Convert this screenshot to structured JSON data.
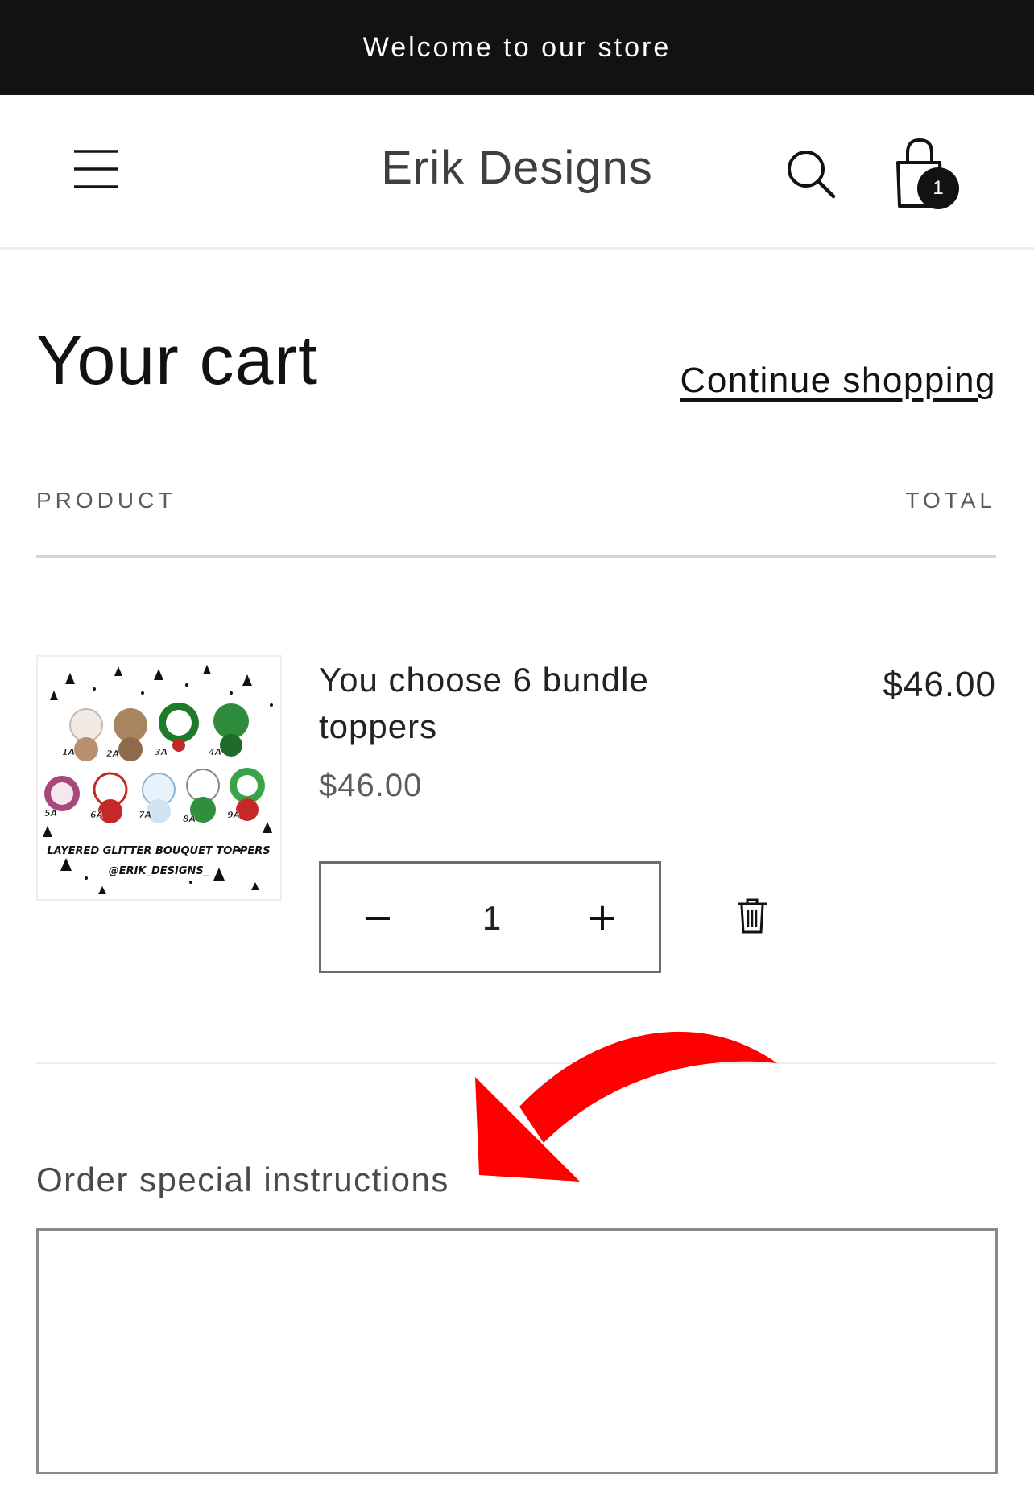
{
  "announcement": {
    "text": "Welcome to our store"
  },
  "header": {
    "store_name": "Erik Designs",
    "cart_count": "1",
    "icons": [
      "hamburger-menu-icon",
      "search-icon",
      "shopping-bag-icon"
    ]
  },
  "cart": {
    "title": "Your cart",
    "continue_label": "Continue shopping",
    "columns": {
      "product": "PRODUCT",
      "total": "TOTAL"
    },
    "items": [
      {
        "title": "You choose 6 bundle toppers",
        "price": "$46.00",
        "total": "$46.00",
        "quantity": "1",
        "image": {
          "banner": "LAYERED GLITTER BOUQUET TOPPERS",
          "handle": "@ERIK_DESIGNS_",
          "labels": [
            "1A",
            "2A",
            "3A",
            "4A",
            "5A",
            "6A",
            "7A",
            "8A",
            "9A"
          ]
        }
      }
    ]
  },
  "notes": {
    "label": "Order special instructions",
    "value": ""
  },
  "colors": {
    "announcement_bg": "#121212",
    "annotation_arrow": "#ff0000",
    "text": "#121212"
  }
}
